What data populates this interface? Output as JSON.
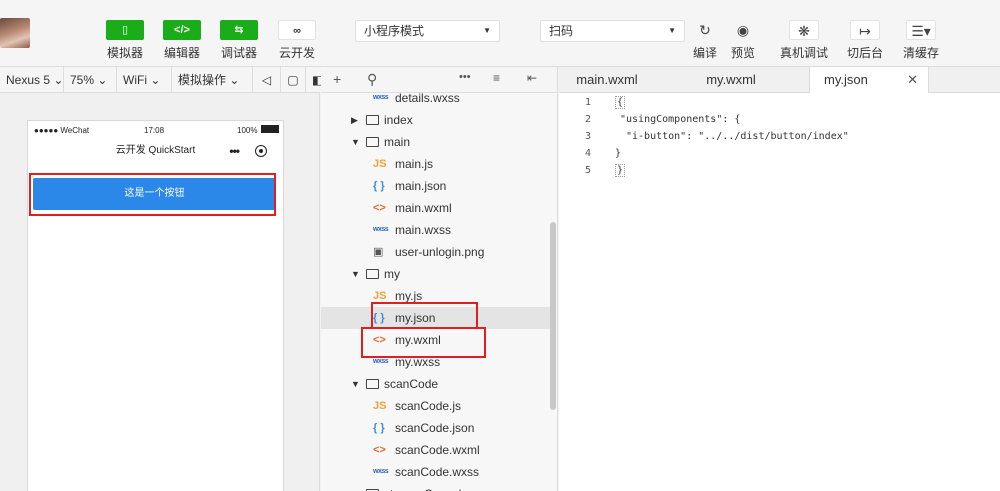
{
  "toolbar": {
    "simulator_label": "模拟器",
    "editor_label": "编辑器",
    "debugger_label": "调试器",
    "cloud_label": "云开发",
    "mode_select": "小程序模式",
    "compile_select": "扫码",
    "compile_label": "编译",
    "preview_label": "预览",
    "realdebug_label": "真机调试",
    "background_label": "切后台",
    "clearcache_label": "清缓存"
  },
  "simbar": {
    "device": "Nexus 5",
    "zoom": "75%",
    "network": "WiFi",
    "operation": "模拟操作"
  },
  "phone": {
    "carrier": "●●●●● WeChat",
    "time": "17:08",
    "battery": "100%",
    "title": "云开发 QuickStart",
    "button_text": "这是一个按钮"
  },
  "tree": {
    "rows": [
      {
        "name": "details.wxss",
        "icon": "wxss",
        "level": 2
      },
      {
        "name": "index",
        "icon": "folder",
        "level": 1,
        "collapsed": true
      },
      {
        "name": "main",
        "icon": "folder",
        "level": 1,
        "collapsed": false
      },
      {
        "name": "main.js",
        "icon": "js",
        "level": 2
      },
      {
        "name": "main.json",
        "icon": "json",
        "level": 2
      },
      {
        "name": "main.wxml",
        "icon": "wxml",
        "level": 2
      },
      {
        "name": "main.wxss",
        "icon": "wxss",
        "level": 2
      },
      {
        "name": "user-unlogin.png",
        "icon": "img",
        "level": 2
      },
      {
        "name": "my",
        "icon": "folder",
        "level": 1,
        "collapsed": false
      },
      {
        "name": "my.js",
        "icon": "js",
        "level": 2
      },
      {
        "name": "my.json",
        "icon": "json",
        "level": 2,
        "selected": true
      },
      {
        "name": "my.wxml",
        "icon": "wxml",
        "level": 2
      },
      {
        "name": "my.wxss",
        "icon": "wxss",
        "level": 2
      },
      {
        "name": "scanCode",
        "icon": "folder",
        "level": 1,
        "collapsed": false
      },
      {
        "name": "scanCode.js",
        "icon": "js",
        "level": 2
      },
      {
        "name": "scanCode.json",
        "icon": "json",
        "level": 2
      },
      {
        "name": "scanCode.wxml",
        "icon": "wxml",
        "level": 2
      },
      {
        "name": "scanCode.wxss",
        "icon": "wxss",
        "level": 2
      },
      {
        "name": "storageConsole",
        "icon": "folder",
        "level": 1,
        "collapsed": false
      }
    ]
  },
  "tabs": {
    "tab1": "main.wxml",
    "tab2": "my.wxml",
    "tab3": "my.json"
  },
  "editor": {
    "lines": [
      {
        "n": "1",
        "text": "{"
      },
      {
        "n": "2",
        "text": "\"usingComponents\": {"
      },
      {
        "n": "3",
        "text": "\"i-button\": \"../../dist/button/index\""
      },
      {
        "n": "4",
        "text": "}"
      },
      {
        "n": "5",
        "text": "}"
      }
    ]
  },
  "colors": {
    "accent_green": "#1aad19",
    "app_button_blue": "#2b87e8",
    "highlight_red": "#e02020"
  }
}
